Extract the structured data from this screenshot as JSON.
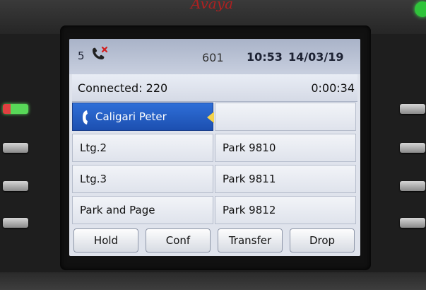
{
  "status": {
    "missed_calls": "5",
    "extension": "601",
    "time": "10:53",
    "date": "14/03/19",
    "icon": "missed-call-icon"
  },
  "connection": {
    "label": "Connected: 220",
    "timer": "0:00:34"
  },
  "lines": {
    "left": [
      {
        "label": "Caligari Peter",
        "active": true,
        "icon": "handset-icon"
      },
      {
        "label": "Ltg.2"
      },
      {
        "label": "Ltg.3"
      },
      {
        "label": "Park and Page"
      }
    ],
    "right": [
      {
        "label": ""
      },
      {
        "label": "Park 9810"
      },
      {
        "label": "Park 9811"
      },
      {
        "label": "Park 9812"
      }
    ]
  },
  "softkeys": [
    "Hold",
    "Conf",
    "Transfer",
    "Drop"
  ],
  "colors": {
    "active_line": "#2f6fd8",
    "status_bar": "#a9b3c8",
    "led_green": "#58d858"
  }
}
